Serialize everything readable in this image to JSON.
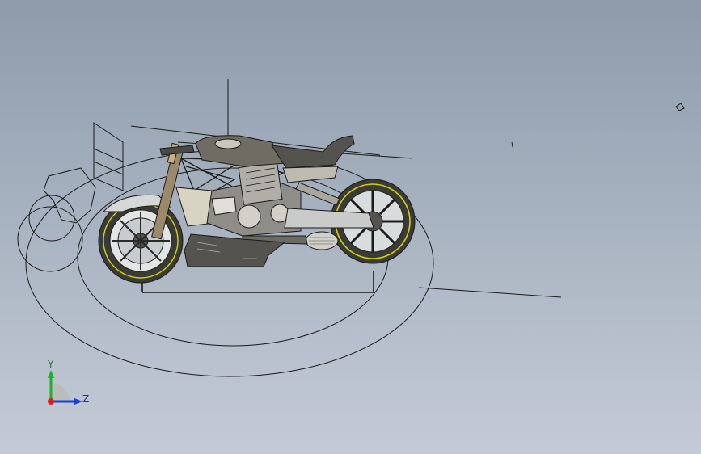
{
  "triad": {
    "y_label": "Y",
    "z_label": "Z",
    "x_color": "#e01b1b",
    "y_color": "#1fae2e",
    "z_color": "#1a3fd6"
  },
  "colors": {
    "line": "#1a1a1a",
    "body_fill": "#7a776e",
    "tire_accent": "#d8d200"
  }
}
